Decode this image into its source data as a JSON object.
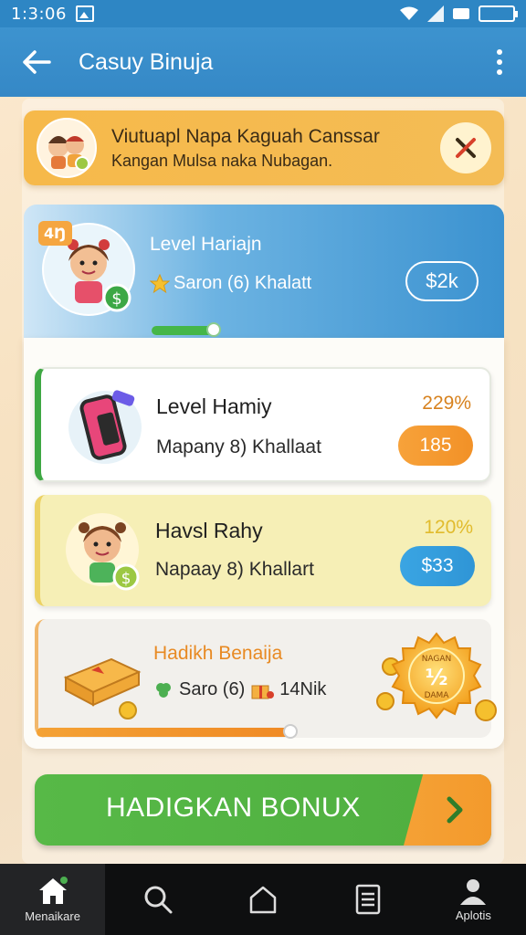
{
  "status_bar": {
    "time": "1:3:06"
  },
  "app_bar": {
    "title": "Casuy Binuja",
    "back_icon": "arrow-left-icon",
    "more_icon": "more-vertical-icon"
  },
  "notice": {
    "title": "Viutuapl Napa Kaguah Canssar",
    "subtitle": "Kangan Mulsa naka Nubagan.",
    "close_icon": "close-icon"
  },
  "level_card": {
    "badge": "4Ŋ",
    "title": "Level Hariajn",
    "meta_text": "Saron (6) Khalatt",
    "amount": "$2k",
    "progress": 0.25
  },
  "items": [
    {
      "title": "Level Hamiy",
      "subtitle": "Mapany 8) Khallaat",
      "percent": "229%",
      "button": "185",
      "color": "#f39a2c"
    },
    {
      "title": "Havsl Rahy",
      "subtitle": "Napaay 8) Khallart",
      "percent": "120%",
      "button": "$33",
      "color": "#3aa5e3"
    },
    {
      "title": "Hadikh Benaija",
      "subtitle": "Saro (6)",
      "subtitle_2": "14Nik"
    }
  ],
  "bonus_badge": {
    "text_top": "NAGAN",
    "text_mid": "½",
    "text_bottom": "DAMA"
  },
  "bonus_progress": 0.55,
  "cta": {
    "label": "HADIGKAN BONUX",
    "arrow_icon": "chevron-right-icon"
  },
  "bottom_nav": [
    {
      "label": "Menaikare",
      "icon": "home-icon",
      "active": true
    },
    {
      "label": "",
      "icon": "search-icon",
      "active": false
    },
    {
      "label": "",
      "icon": "house-outline-icon",
      "active": false
    },
    {
      "label": "",
      "icon": "document-icon",
      "active": false
    },
    {
      "label": "Aplotis",
      "icon": "profile-icon",
      "active": false
    }
  ],
  "colors": {
    "primary_blue": "#3588c6",
    "accent_orange": "#f39a2c",
    "accent_green": "#4fae3f",
    "banner_yellow": "#f6b94a"
  }
}
